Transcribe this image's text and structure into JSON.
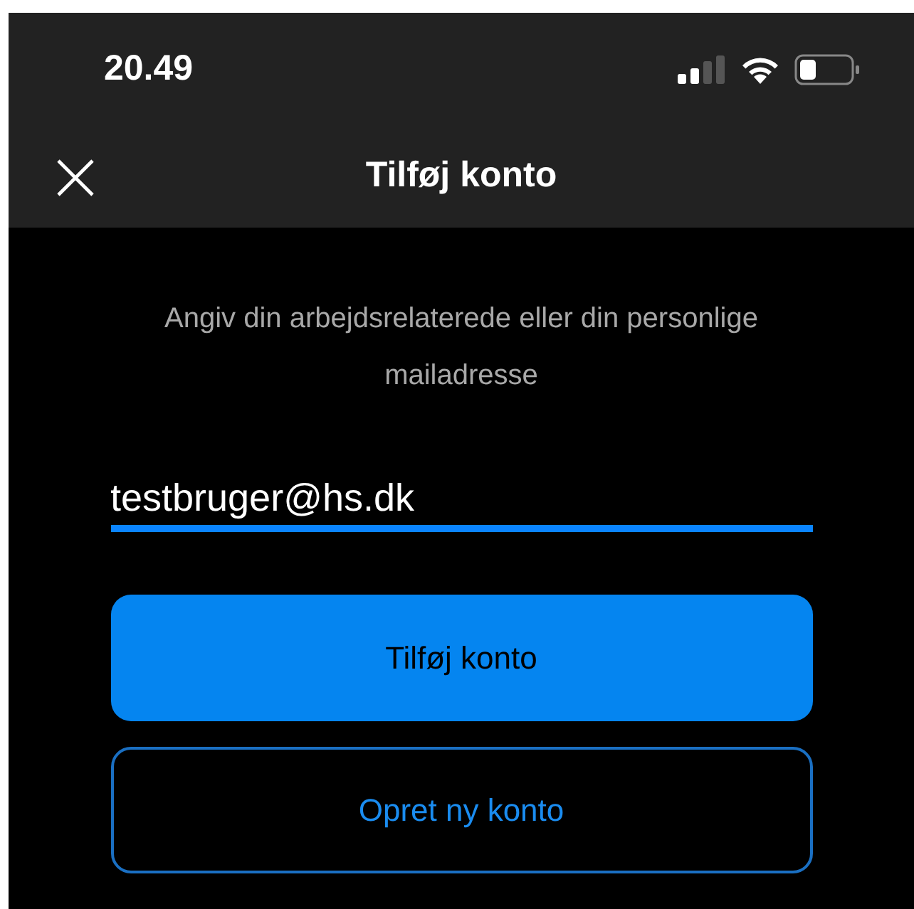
{
  "status_bar": {
    "time": "20.49"
  },
  "header": {
    "title": "Tilføj konto"
  },
  "instructions": "Angiv din arbejdsrelaterede eller din personlige mailadresse",
  "email_field": {
    "value": "testbruger@hs.dk"
  },
  "buttons": [
    {
      "label": "Tilføj konto",
      "kind": "primary"
    },
    {
      "label": "Opret ny konto",
      "kind": "outline"
    }
  ]
}
